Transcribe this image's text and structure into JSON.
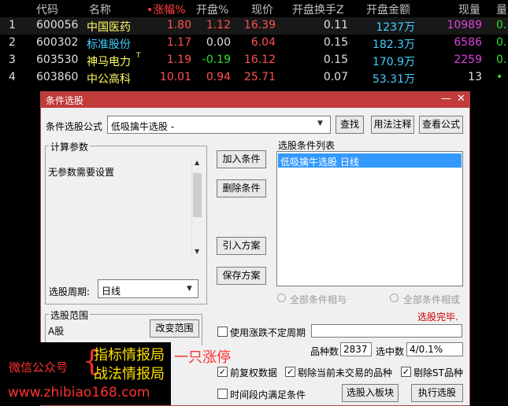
{
  "table": {
    "columns": [
      "代码",
      "名称",
      "•涨幅%",
      "开盘%",
      "现价",
      "开盘换手Z",
      "开盘金额",
      "现量",
      "量"
    ],
    "rows": [
      {
        "idx": "1",
        "code": "600056",
        "name": "中国医药",
        "mark": "",
        "chg": "1.80",
        "open_pct": "1.12",
        "price": "16.39",
        "turnover": "0.11",
        "amount": "1237万",
        "vol": "10989",
        "tail": "0.",
        "chg_color": "#ff5050",
        "open_color": "#ff5050",
        "price_color": "#ff5050",
        "name_color": "#ffff66",
        "vol_color": "#e040e0"
      },
      {
        "idx": "2",
        "code": "600302",
        "name": "标准股份",
        "mark": "",
        "chg": "1.17",
        "open_pct": "0.00",
        "price": "6.04",
        "turnover": "0.15",
        "amount": "182.3万",
        "vol": "6586",
        "tail": "0.",
        "chg_color": "#ff5050",
        "open_color": "#e0e0e0",
        "price_color": "#ff5050",
        "name_color": "#40d0ff",
        "vol_color": "#e040e0"
      },
      {
        "idx": "3",
        "code": "603530",
        "name": "神马电力",
        "mark": "T",
        "chg": "1.19",
        "open_pct": "-0.19",
        "price": "16.12",
        "turnover": "0.15",
        "amount": "170.9万",
        "vol": "2259",
        "tail": "0.",
        "chg_color": "#ff5050",
        "open_color": "#30e030",
        "price_color": "#ff5050",
        "name_color": "#ffff66",
        "vol_color": "#e040e0"
      },
      {
        "idx": "4",
        "code": "603860",
        "name": "中公高科",
        "mark": "",
        "chg": "10.01",
        "open_pct": "0.94",
        "price": "25.71",
        "turnover": "0.07",
        "amount": "53.31万",
        "vol": "13",
        "tail": "•",
        "chg_color": "#ff5050",
        "open_color": "#ff5050",
        "price_color": "#ff5050",
        "name_color": "#ffff66",
        "vol_color": "#e0e0e0"
      }
    ]
  },
  "dialog": {
    "title": "条件选股",
    "formula_label": "条件选股公式",
    "formula_value": "低吸擒牛选股 -",
    "find_button": "查找",
    "usage_button": "用法注释",
    "view_button": "查看公式",
    "params_group": "计算参数",
    "params_text": "无参数需要设置",
    "add_button": "加入条件",
    "delete_button": "删除条件",
    "import_button": "引入方案",
    "save_button": "保存方案",
    "list_label": "选股条件列表",
    "list_items": [
      "低吸擒牛选股  日线"
    ],
    "period_label": "选股周期:",
    "period_value": "日线",
    "radio_and": "全部条件相与",
    "radio_or": "全部条件相或",
    "status": "选股完毕.",
    "range_group": "选股范围",
    "range_value": "A股",
    "change_range_button": "改变范围",
    "uncertain_period": "使用涨跌不定周期",
    "count_label": "品种数",
    "count_value": "2837",
    "selected_label": "选中数",
    "selected_value": "4/0.1%",
    "pre_rights": "前复权数据",
    "exclude_untraded": "剔除当前未交易的品种",
    "exclude_st": "剔除ST品种",
    "time_range": "时间段内满足条件",
    "to_block_button": "选股入板块",
    "run_button": "执行选股"
  },
  "watermark": {
    "wechat": "微信公众号",
    "line1": "指标情报局",
    "line2": "战法情报局",
    "slogan": "一只涨停",
    "url": "www.zhibiao168.com"
  },
  "colors": {
    "header_text": "#c0c0c0",
    "code": "#e0e0e0",
    "dialog_title_bar": "#c23b3b",
    "selection": "#3399ff",
    "status_red": "#d00000"
  }
}
